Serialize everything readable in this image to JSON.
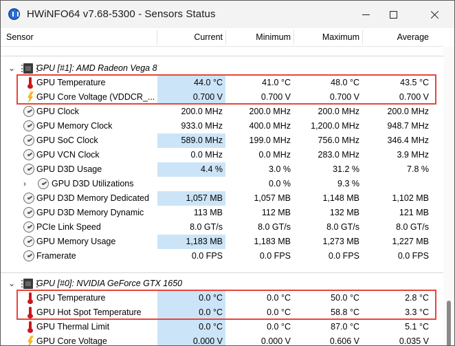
{
  "window": {
    "title": "HWiNFO64 v7.68-5300 - Sensors Status",
    "controls": {
      "minimize": "minimize",
      "maximize": "maximize",
      "close": "close"
    }
  },
  "columns": [
    "Sensor",
    "Current",
    "Minimum",
    "Maximum",
    "Average"
  ],
  "groups": [
    {
      "name": "GPU [#1]: AMD Radeon Vega 8",
      "rows": [
        {
          "icon": "thermometer-icon",
          "label": "GPU Temperature",
          "current": "44.0 °C",
          "minimum": "41.0 °C",
          "maximum": "48.0 °C",
          "average": "43.5 °C",
          "highlight": true
        },
        {
          "icon": "lightning-icon",
          "label": "GPU Core Voltage (VDDCR_...",
          "current": "0.700 V",
          "minimum": "0.700 V",
          "maximum": "0.700 V",
          "average": "0.700 V",
          "highlight": true
        },
        {
          "icon": "gauge-icon",
          "label": "GPU Clock",
          "current": "200.0 MHz",
          "minimum": "200.0 MHz",
          "maximum": "200.0 MHz",
          "average": "200.0 MHz",
          "highlight": false
        },
        {
          "icon": "gauge-icon",
          "label": "GPU Memory Clock",
          "current": "933.0 MHz",
          "minimum": "400.0 MHz",
          "maximum": "1,200.0 MHz",
          "average": "948.7 MHz",
          "highlight": false
        },
        {
          "icon": "gauge-icon",
          "label": "GPU SoC Clock",
          "current": "589.0 MHz",
          "minimum": "199.0 MHz",
          "maximum": "756.0 MHz",
          "average": "346.4 MHz",
          "highlight": true
        },
        {
          "icon": "gauge-icon",
          "label": "GPU VCN Clock",
          "current": "0.0 MHz",
          "minimum": "0.0 MHz",
          "maximum": "283.0 MHz",
          "average": "3.9 MHz",
          "highlight": false
        },
        {
          "icon": "gauge-icon",
          "label": "GPU D3D Usage",
          "current": "4.4 %",
          "minimum": "3.0 %",
          "maximum": "31.2 %",
          "average": "7.8 %",
          "highlight": true
        },
        {
          "icon": "gauge-icon",
          "label": "GPU D3D Utilizations",
          "current": "",
          "minimum": "0.0 %",
          "maximum": "9.3 %",
          "average": "",
          "highlight": false,
          "expandable": true
        },
        {
          "icon": "gauge-icon",
          "label": "GPU D3D Memory Dedicated",
          "current": "1,057 MB",
          "minimum": "1,057 MB",
          "maximum": "1,148 MB",
          "average": "1,102 MB",
          "highlight": true
        },
        {
          "icon": "gauge-icon",
          "label": "GPU D3D Memory Dynamic",
          "current": "113 MB",
          "minimum": "112 MB",
          "maximum": "132 MB",
          "average": "121 MB",
          "highlight": false
        },
        {
          "icon": "gauge-icon",
          "label": "PCIe Link Speed",
          "current": "8.0 GT/s",
          "minimum": "8.0 GT/s",
          "maximum": "8.0 GT/s",
          "average": "8.0 GT/s",
          "highlight": false
        },
        {
          "icon": "gauge-icon",
          "label": "GPU Memory Usage",
          "current": "1,183 MB",
          "minimum": "1,183 MB",
          "maximum": "1,273 MB",
          "average": "1,227 MB",
          "highlight": true
        },
        {
          "icon": "gauge-icon",
          "label": "Framerate",
          "current": "0.0 FPS",
          "minimum": "0.0 FPS",
          "maximum": "0.0 FPS",
          "average": "0.0 FPS",
          "highlight": false
        }
      ]
    },
    {
      "name": "GPU [#0]: NVIDIA GeForce GTX 1650",
      "rows": [
        {
          "icon": "thermometer-icon",
          "label": "GPU Temperature",
          "current": "0.0 °C",
          "minimum": "0.0 °C",
          "maximum": "50.0 °C",
          "average": "2.8 °C",
          "highlight": true
        },
        {
          "icon": "thermometer-icon",
          "label": "GPU Hot Spot Temperature",
          "current": "0.0 °C",
          "minimum": "0.0 °C",
          "maximum": "58.8 °C",
          "average": "3.3 °C",
          "highlight": true
        },
        {
          "icon": "thermometer-icon",
          "label": "GPU Thermal Limit",
          "current": "0.0 °C",
          "minimum": "0.0 °C",
          "maximum": "87.0 °C",
          "average": "5.1 °C",
          "highlight": true
        },
        {
          "icon": "lightning-icon",
          "label": "GPU Core Voltage",
          "current": "0.000 V",
          "minimum": "0.000 V",
          "maximum": "0.606 V",
          "average": "0.035 V",
          "highlight": true
        }
      ]
    }
  ],
  "colors": {
    "highlight": "#cce4f7",
    "annotation_box": "#e8443a"
  }
}
